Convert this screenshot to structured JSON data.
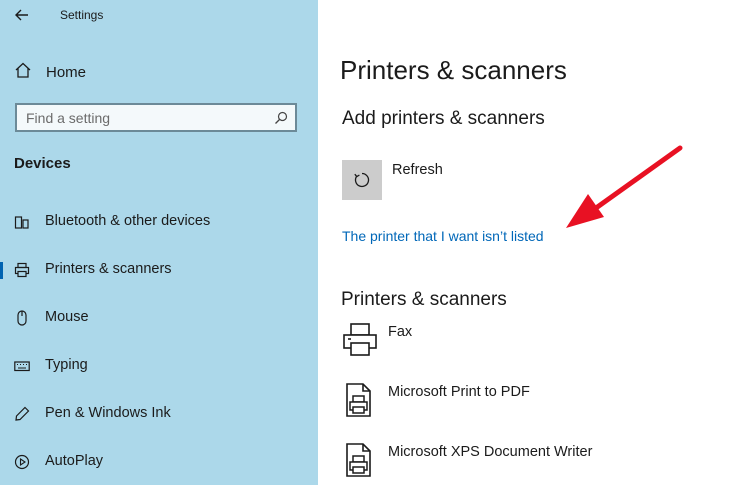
{
  "window": {
    "title": "Settings"
  },
  "sidebar": {
    "home_label": "Home",
    "search_placeholder": "Find a setting",
    "section_heading": "Devices",
    "items": [
      {
        "label": "Bluetooth & other devices",
        "icon": "bluetooth-devices-icon",
        "selected": false
      },
      {
        "label": "Printers & scanners",
        "icon": "printer-icon",
        "selected": true
      },
      {
        "label": "Mouse",
        "icon": "mouse-icon",
        "selected": false
      },
      {
        "label": "Typing",
        "icon": "keyboard-icon",
        "selected": false
      },
      {
        "label": "Pen & Windows Ink",
        "icon": "pen-icon",
        "selected": false
      },
      {
        "label": "AutoPlay",
        "icon": "autoplay-icon",
        "selected": false
      }
    ]
  },
  "main": {
    "title": "Printers & scanners",
    "add_heading": "Add printers & scanners",
    "refresh_label": "Refresh",
    "not_listed_link": "The printer that I want isn’t listed",
    "list_heading": "Printers & scanners",
    "printers": [
      {
        "name": "Fax",
        "icon": "fax-printer-icon"
      },
      {
        "name": "Microsoft Print to PDF",
        "icon": "document-printer-icon"
      },
      {
        "name": "Microsoft XPS Document Writer",
        "icon": "document-printer-icon"
      }
    ]
  },
  "colors": {
    "sidebar_bg": "#acd8ea",
    "link": "#0067b8",
    "accent": "#0063b1",
    "annotation_arrow": "#e81123"
  }
}
